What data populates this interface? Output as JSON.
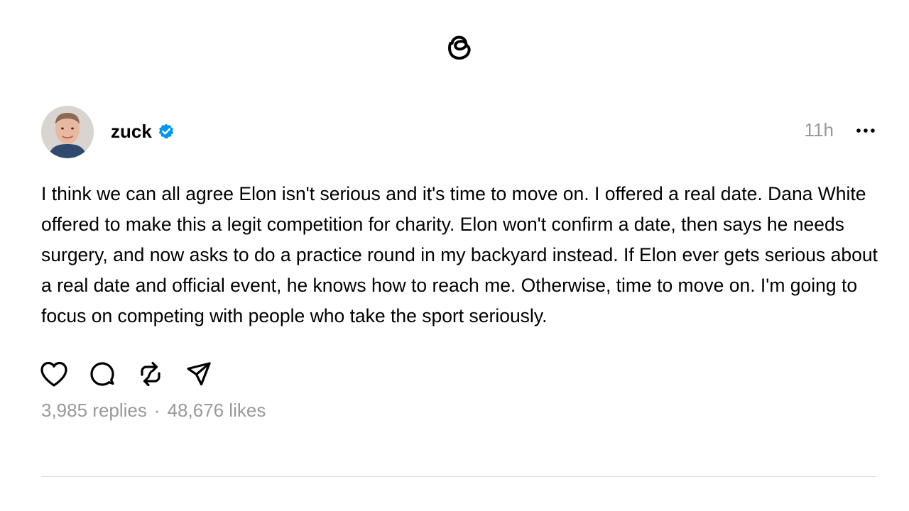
{
  "app": {
    "logo_icon": "threads-logo-icon"
  },
  "post": {
    "author": {
      "username": "zuck",
      "verified": true,
      "avatar_icon": "profile-photo"
    },
    "timestamp": "11h",
    "more_icon": "more-horizontal-icon",
    "text": "I think we can all agree Elon isn't serious and it's time to move on. I offered a real date. Dana White offered to make this a legit competition for charity. Elon won't confirm a date, then says he needs surgery, and now asks to do a practice round in my backyard instead. If Elon ever gets serious about a real date and official event, he knows how to reach me. Otherwise, time to move on. I'm going to focus on competing with people who take the sport seriously.",
    "actions": [
      "heart-icon",
      "comment-icon",
      "repost-icon",
      "share-icon"
    ],
    "stats": {
      "replies": "3,985 replies",
      "separator": "·",
      "likes": "48,676 likes"
    }
  },
  "colors": {
    "verified_badge": "#0095F6",
    "secondary_text": "#999999",
    "divider": "#dcdcdc"
  }
}
